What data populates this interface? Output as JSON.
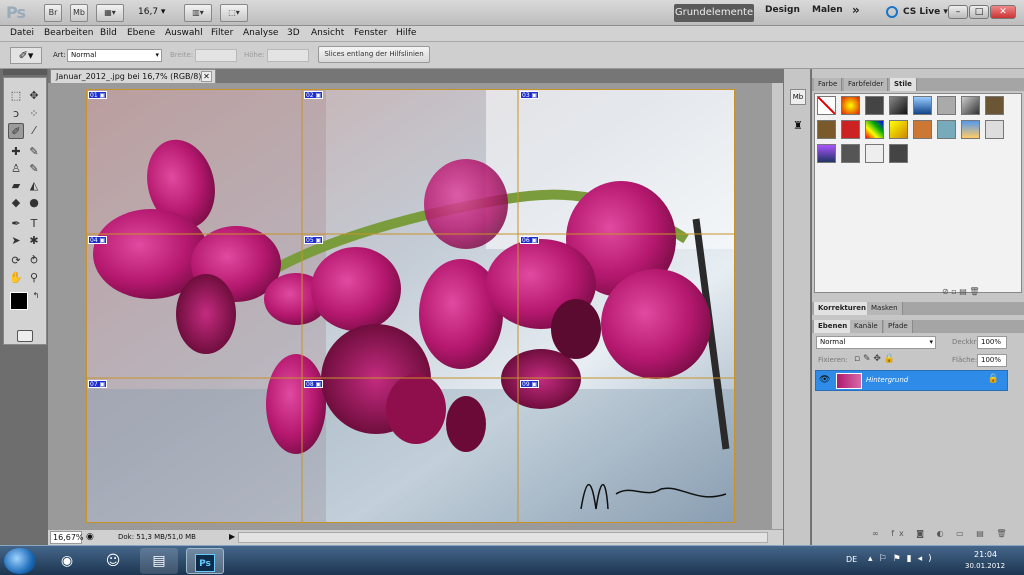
{
  "app": {
    "logo": "Ps",
    "zoom": "16,7",
    "workspaces": [
      "Grundelemente",
      "Design",
      "Malen"
    ],
    "more": "»",
    "cs_live": "CS Live",
    "window_controls": [
      "–",
      "□",
      "✕"
    ]
  },
  "appbar_buttons": [
    "Br",
    "Mb"
  ],
  "menu": [
    "Datei",
    "Bearbeiten",
    "Bild",
    "Ebene",
    "Auswahl",
    "Filter",
    "Analyse",
    "3D",
    "Ansicht",
    "Fenster",
    "Hilfe"
  ],
  "options": {
    "art_label": "Art:",
    "art_value": "Normal",
    "width_label": "Breite:",
    "height_label": "Höhe:",
    "slices_button": "Slices entlang der Hilfslinien"
  },
  "document": {
    "tab_title": "Januar_2012_.jpg bei 16,7% (RGB/8) *",
    "zoom_status": "16,67%",
    "doc_info": "Dok: 51,3 MB/51,0 MB",
    "slices": [
      "01",
      "02",
      "03",
      "04",
      "05",
      "06",
      "07",
      "08",
      "09"
    ],
    "signature": "M Rental-Zeiber"
  },
  "panels": {
    "top_tabs": [
      "Farbe",
      "Farbfelder",
      "Stile"
    ],
    "middle_tabs": [
      "Korrekturen",
      "Masken"
    ],
    "layer_tabs": [
      "Ebenen",
      "Kanäle",
      "Pfade"
    ],
    "blend_mode": "Normal",
    "opacity_label": "Deckkraft:",
    "opacity_value": "100%",
    "lock_label": "Fixieren:",
    "fill_label": "Fläche:",
    "fill_value": "100%",
    "layer_name": "Hintergrund"
  },
  "taskbar": {
    "language": "DE",
    "time": "21:04",
    "date": "30.01.2012"
  },
  "colors": {
    "accent": "#2e8ce8",
    "slice_badge": "#1c2fd0",
    "guide": "#c8922a"
  }
}
